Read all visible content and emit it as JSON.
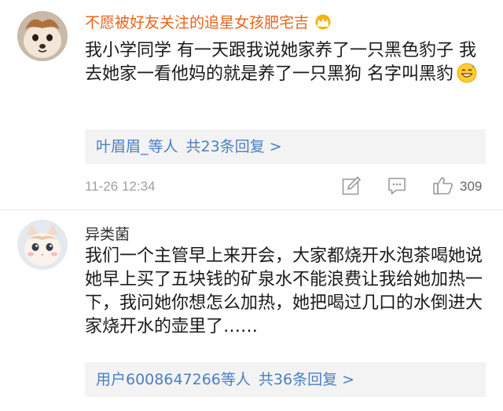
{
  "comments": [
    {
      "username": "不愿被好友关注的追星女孩肥宅吉",
      "text": "我小学同学 有一天跟我说她家养了一只黑色豹子 我去她家一看他妈的就是养了一只黑狗 名字叫黑豹",
      "replies_by": "叶眉眉_等人",
      "replies_count": "共23条回复",
      "chevron": ">",
      "timestamp": "11-26 12:34",
      "likes": "309",
      "icons": [
        "crown-badge-icon",
        "grin-emoji-icon",
        "edit-icon",
        "comment-icon",
        "thumbs-up-icon"
      ]
    },
    {
      "username": "异类菌",
      "text": "我们一个主管早上来开会，大家都烧开水泡茶喝她说她早上买了五块钱的矿泉水不能浪费让我给她加热一下，我问她你想怎么加热，她把喝过几口的水倒进大家烧开水的壶里了……",
      "replies_by": "用户6008647266等人",
      "replies_count": "共36条回复",
      "chevron": ">"
    }
  ],
  "colors": {
    "username_highlight": "#e8641a",
    "link": "#4a7fc1",
    "reply_bg": "#f3f3f3",
    "meta_gray": "#a0a0a0"
  }
}
